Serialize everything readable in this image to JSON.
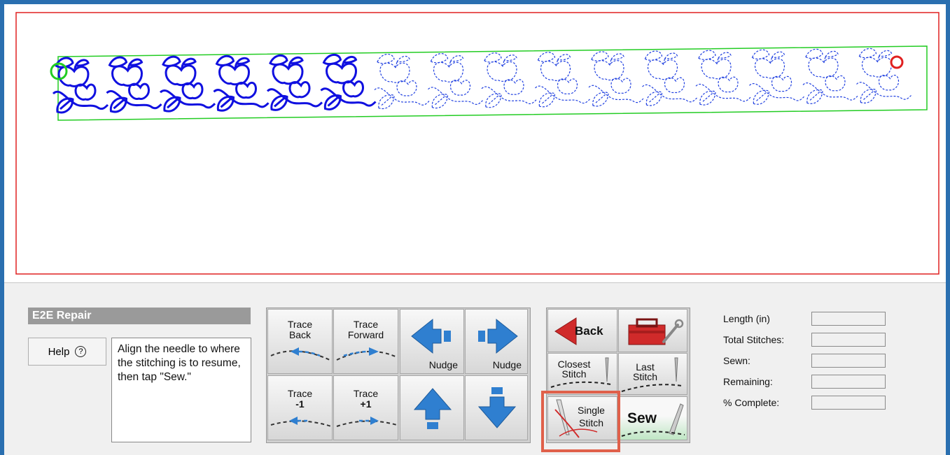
{
  "mode": {
    "title": "E2E Repair"
  },
  "help": {
    "label": "Help",
    "icon": "question-circle-icon"
  },
  "instructions": {
    "text": "Align the needle to where the stitching is to resume, then tap \"Sew.\""
  },
  "trace_buttons": {
    "trace_back": [
      "Trace",
      "Back"
    ],
    "trace_forward": [
      "Trace",
      "Forward"
    ],
    "trace_minus1": [
      "Trace",
      "-1"
    ],
    "trace_plus1": [
      "Trace",
      "+1"
    ]
  },
  "nudge_buttons": {
    "nudge_left": "Nudge",
    "nudge_right": "Nudge",
    "nudge_up_icon": "arrow-up-icon",
    "nudge_down_icon": "arrow-down-icon"
  },
  "action_buttons": {
    "back": "Back",
    "toolbox_icon": "toolbox-icon",
    "closest_stitch": [
      "Closest",
      "Stitch"
    ],
    "last_stitch": [
      "Last",
      "Stitch"
    ],
    "single_stitch": [
      "Single",
      "Stitch"
    ],
    "sew": "Sew"
  },
  "stats": {
    "length_label": "Length (in)",
    "length_value": "",
    "total_label": "Total Stitches:",
    "total_value": "",
    "sewn_label": "Sewn:",
    "sewn_value": "",
    "remaining_label": "Remaining:",
    "remaining_value": "",
    "complete_label": "% Complete:",
    "complete_value": ""
  },
  "colors": {
    "window_border": "#2a6fb0",
    "canvas_bounds": "#e02020",
    "design_boundary": "#22cc22",
    "stitch_sewn": "#1010e0",
    "stitch_pending": "#2040e0",
    "arrow_blue": "#2f7fd0",
    "highlight": "#e0604a"
  },
  "design": {
    "motif": "apple-and-leaf pantograph",
    "sewn_repeats": 6,
    "total_repeats": 16,
    "start_marker": "green-circle",
    "end_marker": "red-circle"
  }
}
